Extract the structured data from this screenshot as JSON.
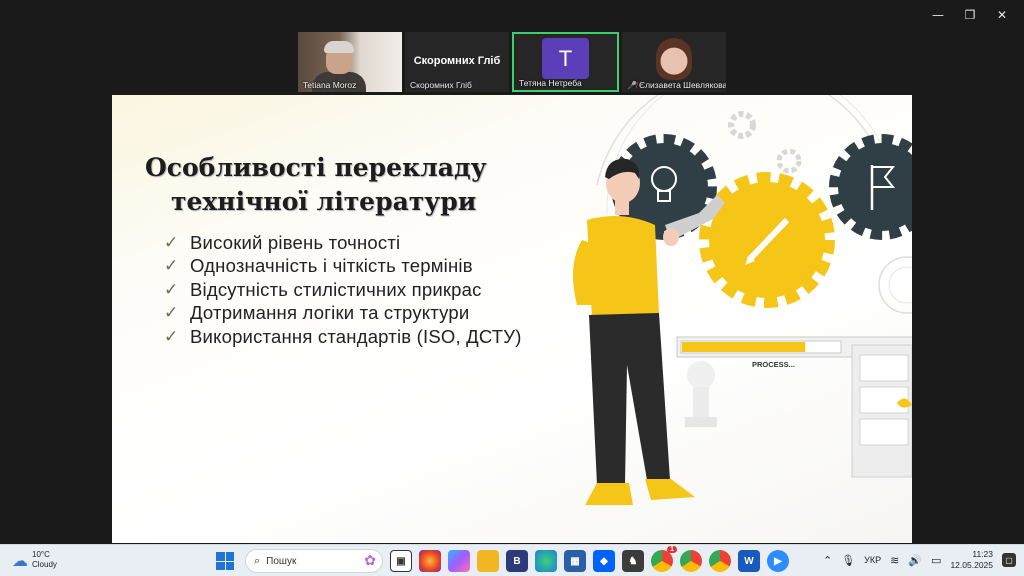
{
  "window_controls": {
    "minimize": "—",
    "restore": "❐",
    "close": "✕"
  },
  "participants": [
    {
      "name": "Tetiana Moroz"
    },
    {
      "name": "Скоромних Гліб",
      "display": "Скоромних Гліб"
    },
    {
      "name": "Тетяна Нетреба",
      "initial": "T"
    },
    {
      "name": "Єлизавета Шевлякова",
      "muted": true
    }
  ],
  "slide": {
    "title_line1": "Особливості перекладу",
    "title_line2": "технічної літератури",
    "bullets": [
      "Високий рівень точності",
      "Однозначність і чіткість термінів",
      "Відсутність стилістичних прикрас",
      "Дотримання логіки та структури",
      "Використання стандартів (ISO, ДСТУ)"
    ],
    "illustration_label": "PROCESS...",
    "progress": 0.78,
    "colors": {
      "gear_dark": "#2f3f45",
      "gear_yellow": "#f5c518",
      "shirt": "#f5c518"
    }
  },
  "taskbar": {
    "weather_temp": "10°C",
    "weather_desc": "Cloudy",
    "search_placeholder": "Пошук",
    "language": "УКР",
    "time": "11:23",
    "date": "12.05.2025",
    "apps": [
      "task-view",
      "firefox",
      "copilot",
      "file-explorer",
      "b-app",
      "edge",
      "store",
      "dropbox",
      "chess",
      "chrome",
      "chrome",
      "chrome",
      "word",
      "zoom"
    ],
    "chrome_badge": "1"
  }
}
